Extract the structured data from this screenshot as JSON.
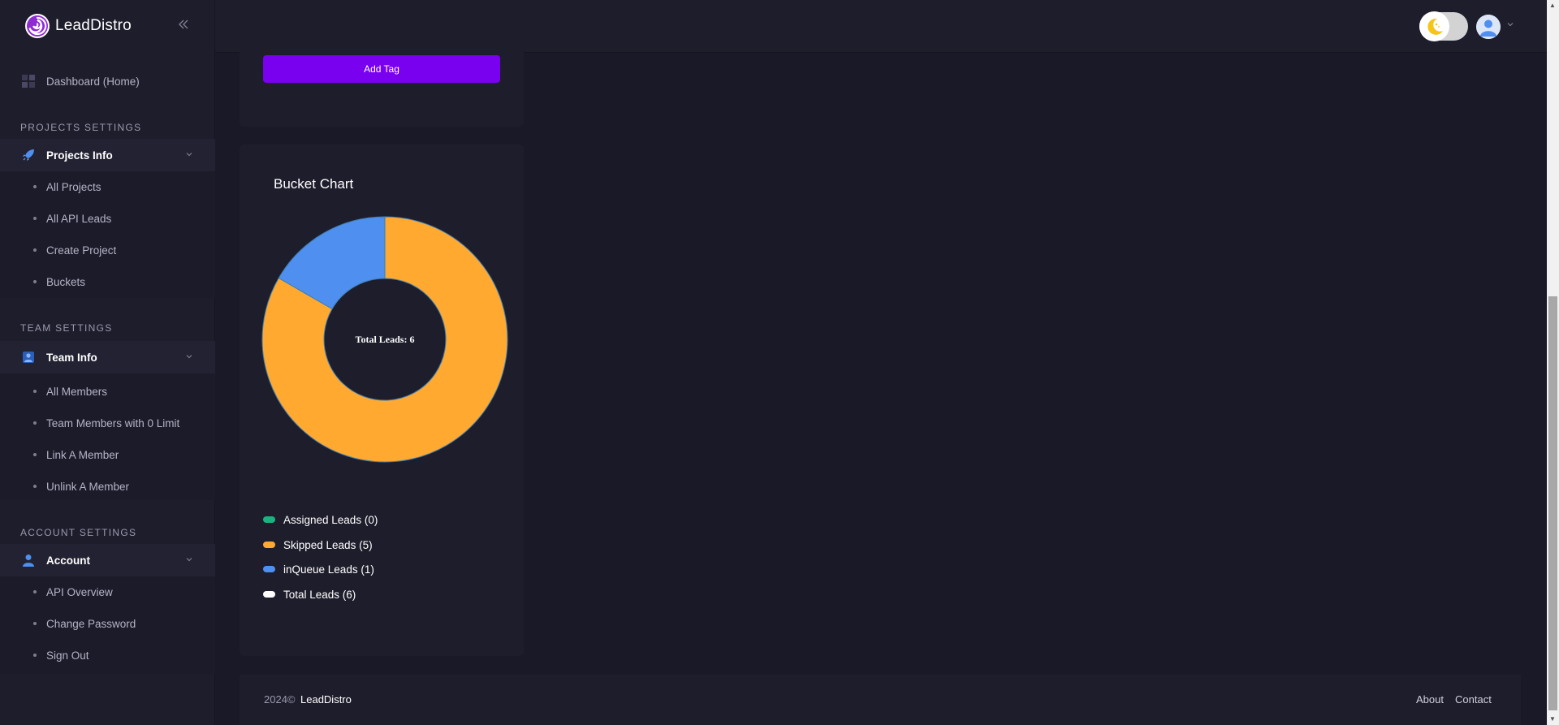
{
  "app": {
    "brand": "LeadDistro"
  },
  "sidebar": {
    "dashboard": "Dashboard (Home)",
    "sections": {
      "projects": "PROJECTS SETTINGS",
      "team": "TEAM SETTINGS",
      "account": "ACCOUNT SETTINGS"
    },
    "projects_info": {
      "label": "Projects Info",
      "items": [
        "All Projects",
        "All API Leads",
        "Create Project",
        "Buckets"
      ]
    },
    "team_info": {
      "label": "Team Info",
      "items": [
        "All Members",
        "Team Members with 0 Limit",
        "Link A Member",
        "Unlink A Member"
      ]
    },
    "account": {
      "label": "Account",
      "items": [
        "API Overview",
        "Change Password",
        "Sign Out"
      ]
    }
  },
  "tags_card": {
    "add_button": "Add Tag"
  },
  "bucket_card": {
    "title": "Bucket Chart",
    "center_label": "Total Leads: 6"
  },
  "chart_data": {
    "type": "pie",
    "title": "Bucket Chart",
    "categories": [
      "Assigned Leads",
      "Skipped Leads",
      "inQueue Leads"
    ],
    "values": [
      0,
      5,
      1
    ],
    "colors": [
      "#19b47e",
      "#ffa931",
      "#4e8ff0"
    ],
    "center_text": "Total Leads: 6",
    "legend": [
      {
        "label": "Assigned Leads (0)",
        "color": "#19b47e"
      },
      {
        "label": "Skipped Leads (5)",
        "color": "#ffa931"
      },
      {
        "label": "inQueue Leads (1)",
        "color": "#4e8ff0"
      },
      {
        "label": "Total Leads (6)",
        "color": "#ffffff"
      }
    ]
  },
  "footer": {
    "year": "2024©",
    "brand": "LeadDistro",
    "about": "About",
    "contact": "Contact"
  },
  "icons": {
    "logo": "spiral-logo-icon",
    "collapse": "double-chevron-left-icon",
    "theme": "moon-icon",
    "user": "user-avatar-icon"
  }
}
